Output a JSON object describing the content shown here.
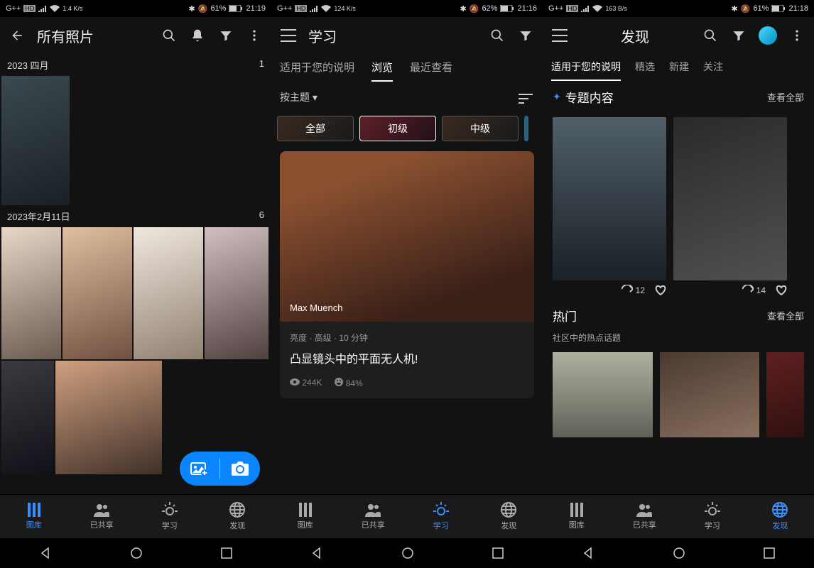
{
  "screens": [
    {
      "statusLeft": "G++",
      "statusHD": "HD",
      "netSpeed": "1.4 K/s",
      "battery": "61%",
      "time": "21:19",
      "title": "所有照片",
      "groups": [
        {
          "label": "2023 四月",
          "count": "1"
        },
        {
          "label": "2023年2月11日",
          "count": "6"
        }
      ],
      "nav": {
        "gallery": "图库",
        "shared": "已共享",
        "learn": "学习",
        "discover": "发现"
      },
      "activeNav": 0
    },
    {
      "statusLeft": "G++",
      "statusHD": "HD",
      "netSpeed": "124 K/s",
      "battery": "62%",
      "time": "21:16",
      "title": "学习",
      "tabs": [
        "适用于您的说明",
        "浏览",
        "最近查看"
      ],
      "activeTab": 1,
      "filterLabel": "按主题",
      "chips": [
        "全部",
        "初级",
        "中级"
      ],
      "activeChip": 1,
      "course": {
        "author": "Max Muench",
        "tags": "亮度 · 高级 · 10 分钟",
        "title": "凸显镜头中的平面无人机!",
        "views": "244K",
        "like": "84%"
      },
      "nav": {
        "gallery": "图库",
        "shared": "已共享",
        "learn": "学习",
        "discover": "发现"
      },
      "activeNav": 2
    },
    {
      "statusLeft": "G++",
      "statusHD": "HD",
      "netSpeed": "163 B/s",
      "battery": "61%",
      "time": "21:18",
      "title": "发现",
      "tabs": [
        "适用于您的说明",
        "精选",
        "新建",
        "关注"
      ],
      "activeTab": 0,
      "featuredTitle": "专题内容",
      "viewAll": "查看全部",
      "cards": [
        {
          "remix": "12"
        },
        {
          "remix": "14"
        }
      ],
      "hotTitle": "热门",
      "hotDesc": "社区中的热点话题",
      "nav": {
        "gallery": "图库",
        "shared": "已共享",
        "learn": "学习",
        "discover": "发现"
      },
      "activeNav": 3
    }
  ]
}
